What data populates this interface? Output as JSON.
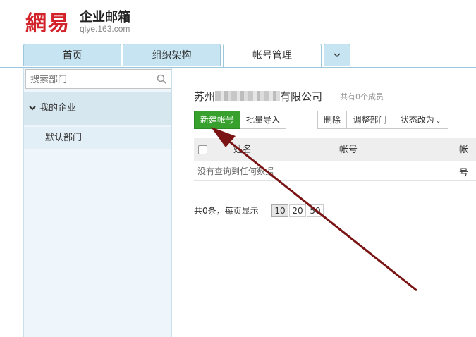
{
  "header": {
    "logo_text": "網易",
    "product_title": "企业邮箱",
    "domain": "qiye.163.com"
  },
  "tabs": [
    {
      "label": "首页",
      "active": false
    },
    {
      "label": "组织架构",
      "active": false
    },
    {
      "label": "帐号管理",
      "active": true
    }
  ],
  "more_tab_icon": "chevron-down-icon",
  "sidebar": {
    "search_placeholder": "搜索部门",
    "root_label": "我的企业",
    "child_label": "默认部门"
  },
  "main": {
    "company_prefix": "苏州",
    "company_suffix": "有限公司",
    "member_count": "共有0个成员",
    "buttons": {
      "new_account": "新建帐号",
      "batch_import": "批量导入",
      "delete": "删除",
      "adjust_department": "调整部门",
      "change_status": "状态改为"
    },
    "table": {
      "columns": [
        "姓名",
        "帐号",
        "帐号"
      ],
      "empty_text": "没有查询到任何数据"
    },
    "pager": {
      "summary": "共0条，每页显示",
      "options": [
        "10",
        "20",
        "50"
      ],
      "selected": "10"
    }
  },
  "colors": {
    "primary_button": "#38a02d",
    "tab_background": "#c6e4f1",
    "logo_red": "#d2222a",
    "annotation_arrow": "#7a1414"
  }
}
